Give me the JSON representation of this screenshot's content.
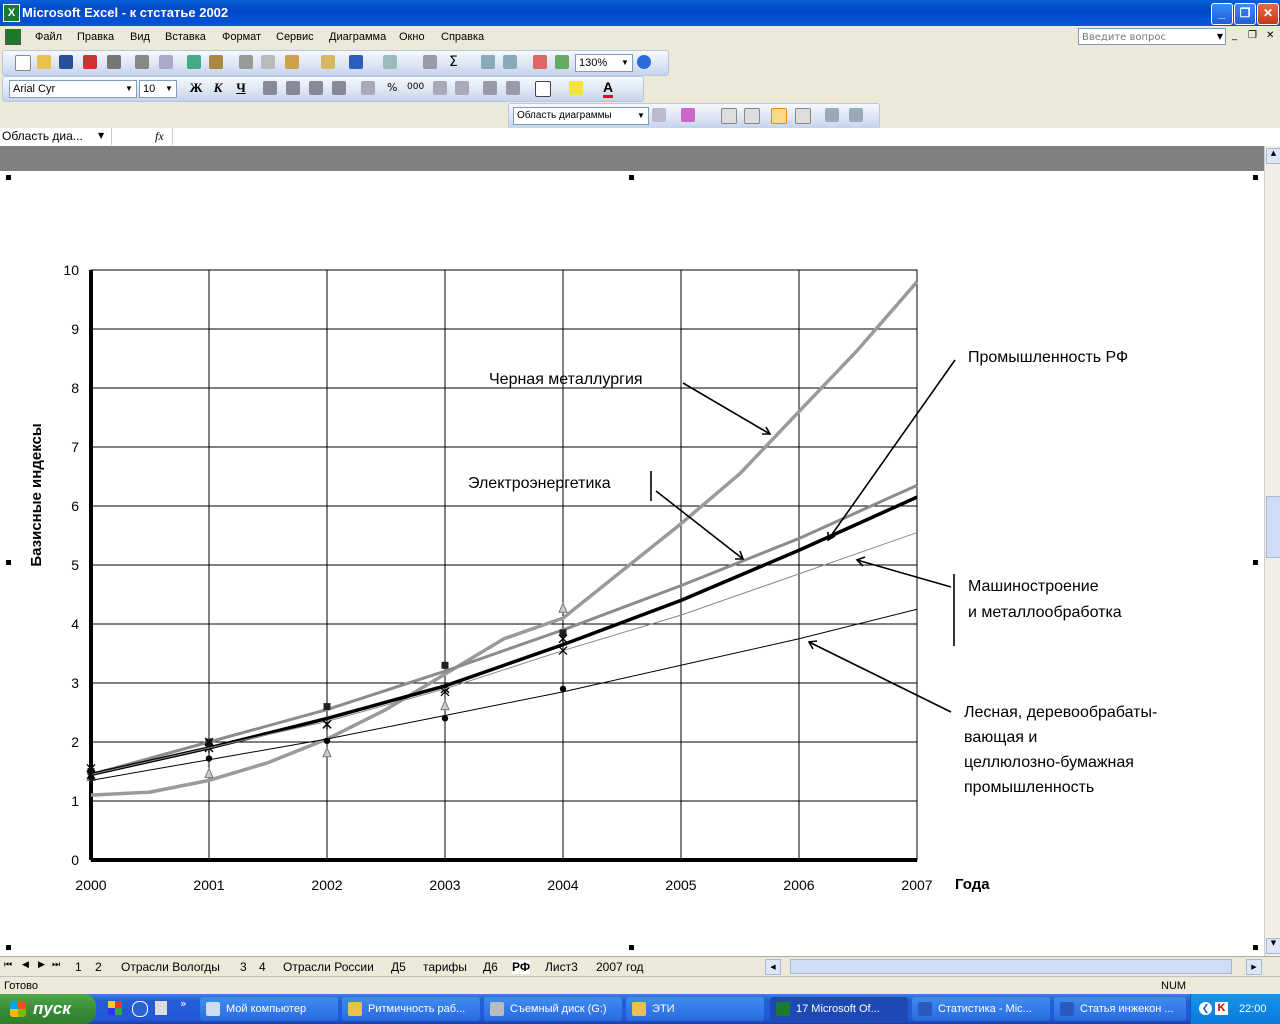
{
  "window": {
    "title": "Microsoft Excel - к стстатье 2002",
    "app_icon": "excel-icon"
  },
  "menu": {
    "items": [
      "Файл",
      "Правка",
      "Вид",
      "Вставка",
      "Формат",
      "Сервис",
      "Диаграмма",
      "Окно",
      "Справка"
    ],
    "ask_placeholder": "Введите вопрос"
  },
  "toolbar": {
    "zoom": "130%",
    "font_name": "Arial Cyr",
    "font_size": "10",
    "bold": "Ж",
    "italic": "К",
    "underline": "Ч",
    "chart_object": "Область диаграммы"
  },
  "formula_bar": {
    "name_box": "Область диа...",
    "fx": "fx"
  },
  "chart_data": {
    "type": "line",
    "ylabel": "Базисные индексы",
    "xlabel": "Года",
    "ylim": [
      0,
      10
    ],
    "xlim": [
      2000,
      2007
    ],
    "x_ticks": [
      2000,
      2001,
      2002,
      2003,
      2004,
      2005,
      2006,
      2007
    ],
    "y_ticks": [
      0,
      1,
      2,
      3,
      4,
      5,
      6,
      7,
      8,
      9,
      10
    ],
    "grid": true,
    "series": [
      {
        "name": "Черная металлургия",
        "color": "#9a9a9a",
        "marker": "triangle",
        "points": [
          [
            2000,
            1.4
          ],
          [
            2001,
            1.45
          ],
          [
            2002,
            1.8
          ],
          [
            2003,
            2.6
          ],
          [
            2004,
            4.25
          ]
        ],
        "trend": [
          [
            2000,
            1.1
          ],
          [
            2000.5,
            1.15
          ],
          [
            2001,
            1.35
          ],
          [
            2001.5,
            1.65
          ],
          [
            2002,
            2.05
          ],
          [
            2002.5,
            2.55
          ],
          [
            2003,
            3.15
          ],
          [
            2003.5,
            3.75
          ],
          [
            2004,
            4.1
          ],
          [
            2004.5,
            4.9
          ],
          [
            2005,
            5.7
          ],
          [
            2005.5,
            6.55
          ],
          [
            2006,
            7.6
          ],
          [
            2006.5,
            8.65
          ],
          [
            2007,
            9.8
          ]
        ]
      },
      {
        "name": "Электроэнергетика",
        "color": "#8c8c8c",
        "marker": "square",
        "points": [
          [
            2000,
            1.5
          ],
          [
            2001,
            2.0
          ],
          [
            2002,
            2.6
          ],
          [
            2003,
            3.3
          ],
          [
            2004,
            3.85
          ]
        ],
        "trend": [
          [
            2000,
            1.45
          ],
          [
            2001,
            2.0
          ],
          [
            2002,
            2.55
          ],
          [
            2003,
            3.2
          ],
          [
            2004,
            3.9
          ],
          [
            2005,
            4.65
          ],
          [
            2006,
            5.45
          ],
          [
            2007,
            6.35
          ]
        ]
      },
      {
        "name": "Промышленность РФ",
        "color": "#000000",
        "marker": "star",
        "points": [
          [
            2000,
            1.55
          ],
          [
            2001,
            1.9
          ],
          [
            2002,
            2.3
          ],
          [
            2003,
            2.9
          ],
          [
            2004,
            3.75
          ]
        ],
        "trend": [
          [
            2000,
            1.45
          ],
          [
            2001,
            1.9
          ],
          [
            2002,
            2.4
          ],
          [
            2003,
            2.95
          ],
          [
            2004,
            3.65
          ],
          [
            2005,
            4.4
          ],
          [
            2006,
            5.25
          ],
          [
            2007,
            6.15
          ]
        ]
      },
      {
        "name": "Машиностроение и металлообработка",
        "color": "#8a8a8a",
        "marker": "x",
        "points": [
          [
            2000,
            1.45
          ],
          [
            2001,
            2.0
          ],
          [
            2002,
            2.3
          ],
          [
            2003,
            2.85
          ],
          [
            2004,
            3.55
          ]
        ],
        "trend": [
          [
            2000,
            1.45
          ],
          [
            2001,
            1.9
          ],
          [
            2002,
            2.35
          ],
          [
            2003,
            2.9
          ],
          [
            2004,
            3.55
          ],
          [
            2005,
            4.15
          ],
          [
            2006,
            4.85
          ],
          [
            2007,
            5.55
          ]
        ]
      },
      {
        "name": "Лесная, деревообрабатывающая и целлюлозно-бумажная промышленность",
        "color": "#000000",
        "marker": "dot",
        "points": [
          [
            2000,
            1.4
          ],
          [
            2001,
            1.72
          ],
          [
            2002,
            2.02
          ],
          [
            2003,
            2.4
          ],
          [
            2004,
            2.9
          ]
        ],
        "trend": [
          [
            2000,
            1.35
          ],
          [
            2001,
            1.7
          ],
          [
            2002,
            2.05
          ],
          [
            2003,
            2.45
          ],
          [
            2004,
            2.85
          ],
          [
            2005,
            3.3
          ],
          [
            2006,
            3.75
          ],
          [
            2007,
            4.25
          ]
        ]
      }
    ],
    "annotations": {
      "black_metallurgy": "Черная металлургия",
      "power": "Электроэнергетика",
      "industry_rf": "Промышленность РФ",
      "machine_line1": "Машиностроение",
      "machine_line2": "и металлообработка",
      "forest_line1": "Лесная, деревообрабаты-",
      "forest_line2": "вающая и",
      "forest_line3": "целлюлозно-бумажная",
      "forest_line4": "промышленность"
    }
  },
  "sheet_tabs": [
    "1",
    "2",
    "Отрасли Вологды",
    "3",
    "4",
    "Отрасли России",
    "Д5",
    "тарифы",
    "Д6",
    "РФ",
    "Лист3",
    "2007 год"
  ],
  "active_tab": "РФ",
  "status": {
    "left": "Готово",
    "num": "NUM"
  },
  "taskbar": {
    "start": "пуск",
    "tasks": [
      "Мой компьютер",
      "Ритмичность раб...",
      "Съемный диск (G:)",
      "ЭТИ",
      "17 Microsoft Of...",
      "Статистика - Mic...",
      "Статья инжекон ..."
    ],
    "clock": "22:00"
  }
}
